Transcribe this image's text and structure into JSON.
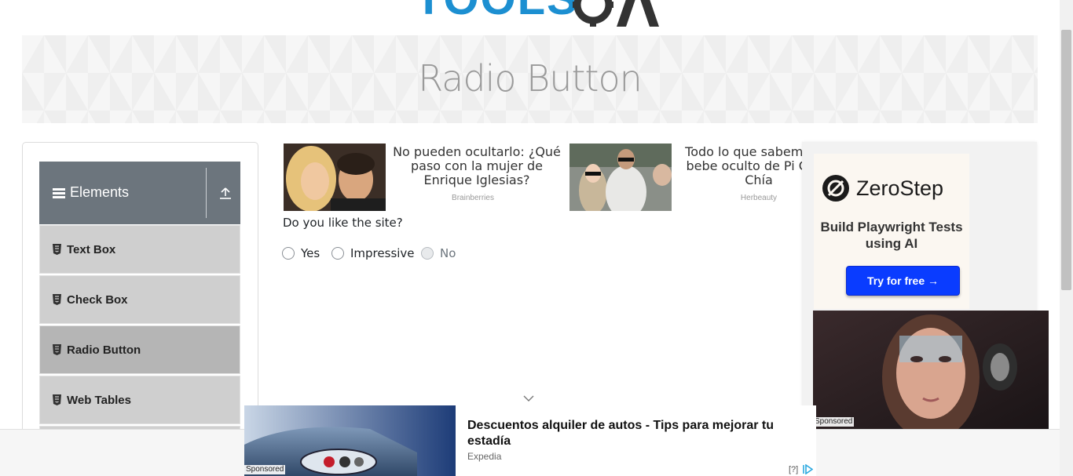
{
  "logo": {
    "text": "TOOLS",
    "alt_icon": "gear-qa-logo"
  },
  "banner": {
    "title": "Radio Button"
  },
  "sidebar": {
    "group_label": "Elements",
    "items": [
      {
        "label": "Text Box",
        "active": false
      },
      {
        "label": "Check Box",
        "active": false
      },
      {
        "label": "Radio Button",
        "active": true
      },
      {
        "label": "Web Tables",
        "active": false
      }
    ]
  },
  "content_ads": [
    {
      "headline": "No pueden ocultarlo: ¿Qué paso con la mujer de Enrique Iglesias?",
      "source": "Brainberries"
    },
    {
      "headline": "Todo lo que sabemos el bebe oculto de Pi Clara Chía",
      "source": "Herbeauty"
    }
  ],
  "question": {
    "text": "Do you like the site?"
  },
  "radio_options": [
    {
      "label": "Yes",
      "disabled": false
    },
    {
      "label": "Impressive",
      "disabled": false
    },
    {
      "label": "No",
      "disabled": true
    }
  ],
  "right_ad": {
    "brand": "ZeroStep",
    "tagline": "Build Playwright Tests using AI",
    "cta": "Try for free →",
    "sponsored": "Sponsored"
  },
  "bottom_ad": {
    "title": "Descuentos alquiler de autos - Tips para mejorar tu estadía",
    "source": "Expedia",
    "sponsored": "Sponsored",
    "info": "[?]"
  },
  "colors": {
    "accent": "#1c8fd1",
    "sidebar_header": "#6c757d",
    "cta": "#0a3cff"
  }
}
